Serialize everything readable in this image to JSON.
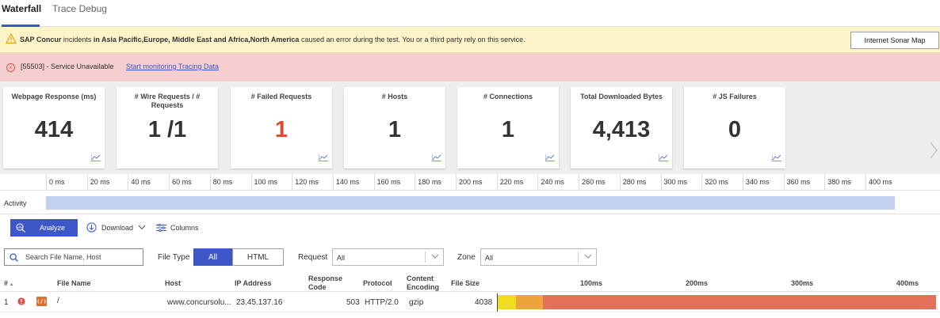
{
  "tabs": [
    {
      "label": "Waterfall",
      "active": true
    },
    {
      "label": "Trace Debug",
      "active": false
    }
  ],
  "warning": {
    "prefix_bold": "SAP Concur",
    "text1": " incidents ",
    "regions_bold": "in Asia Pacific,Europe, Middle East and Africa,North America",
    "text2": " caused an error during the test. You or a third party rely on this service.",
    "button": "Internet Sonar Map"
  },
  "error": {
    "text": "[55503] - Service Unavailable",
    "link": "Start monitoring Tracing Data"
  },
  "metrics": [
    {
      "label": "Webpage Response (ms)",
      "value": "414",
      "status": "normal"
    },
    {
      "label": "# Wire Requests / # Requests",
      "value": "1 /1",
      "status": "normal"
    },
    {
      "label": "# Failed Requests",
      "value": "1",
      "status": "error"
    },
    {
      "label": "# Hosts",
      "value": "1",
      "status": "normal"
    },
    {
      "label": "# Connections",
      "value": "1",
      "status": "normal"
    },
    {
      "label": "Total Downloaded Bytes",
      "value": "4,413",
      "status": "normal"
    },
    {
      "label": "# JS Failures",
      "value": "0",
      "status": "normal"
    }
  ],
  "timeline": {
    "ticks": [
      "0 ms",
      "20 ms",
      "40 ms",
      "60 ms",
      "80 ms",
      "100 ms",
      "120 ms",
      "140 ms",
      "160 ms",
      "180 ms",
      "200 ms",
      "220 ms",
      "240 ms",
      "260 ms",
      "280 ms",
      "300 ms",
      "320 ms",
      "340 ms",
      "360 ms",
      "380 ms",
      "400 ms"
    ],
    "row_label": "Activity"
  },
  "toolbar": {
    "analyze": "Analyze",
    "download": "Download",
    "columns": "Columns"
  },
  "filters": {
    "search_placeholder": "Search File Name, Host",
    "file_type_label": "File Type",
    "file_type_options": [
      "All",
      "HTML"
    ],
    "file_type_selected": "All",
    "request_label": "Request",
    "request_value": "All",
    "zone_label": "Zone",
    "zone_value": "All"
  },
  "table": {
    "headers": {
      "num": "#",
      "file_name": "File Name",
      "host": "Host",
      "ip": "IP Address",
      "response_code": "Response Code",
      "protocol": "Protocol",
      "content_encoding": "Content Encoding",
      "file_size": "File Size"
    },
    "waterfall_ticks": [
      "100ms",
      "200ms",
      "300ms",
      "400ms"
    ],
    "rows": [
      {
        "num": "1",
        "file_name": "/",
        "host": "www.concursolu...",
        "ip": "23.45.137.16",
        "response_code": "503",
        "protocol": "HTTP/2.0",
        "content_encoding": "gzip",
        "file_size": "4038"
      }
    ]
  },
  "colors": {
    "accent": "#3d57c9",
    "warning_bg": "#fcf3c8",
    "error_bg": "#f5cfcf",
    "activity": "#c4d0ef",
    "waterfall_segments": [
      "#f0de1e",
      "#efa43a",
      "#e4705a"
    ]
  }
}
